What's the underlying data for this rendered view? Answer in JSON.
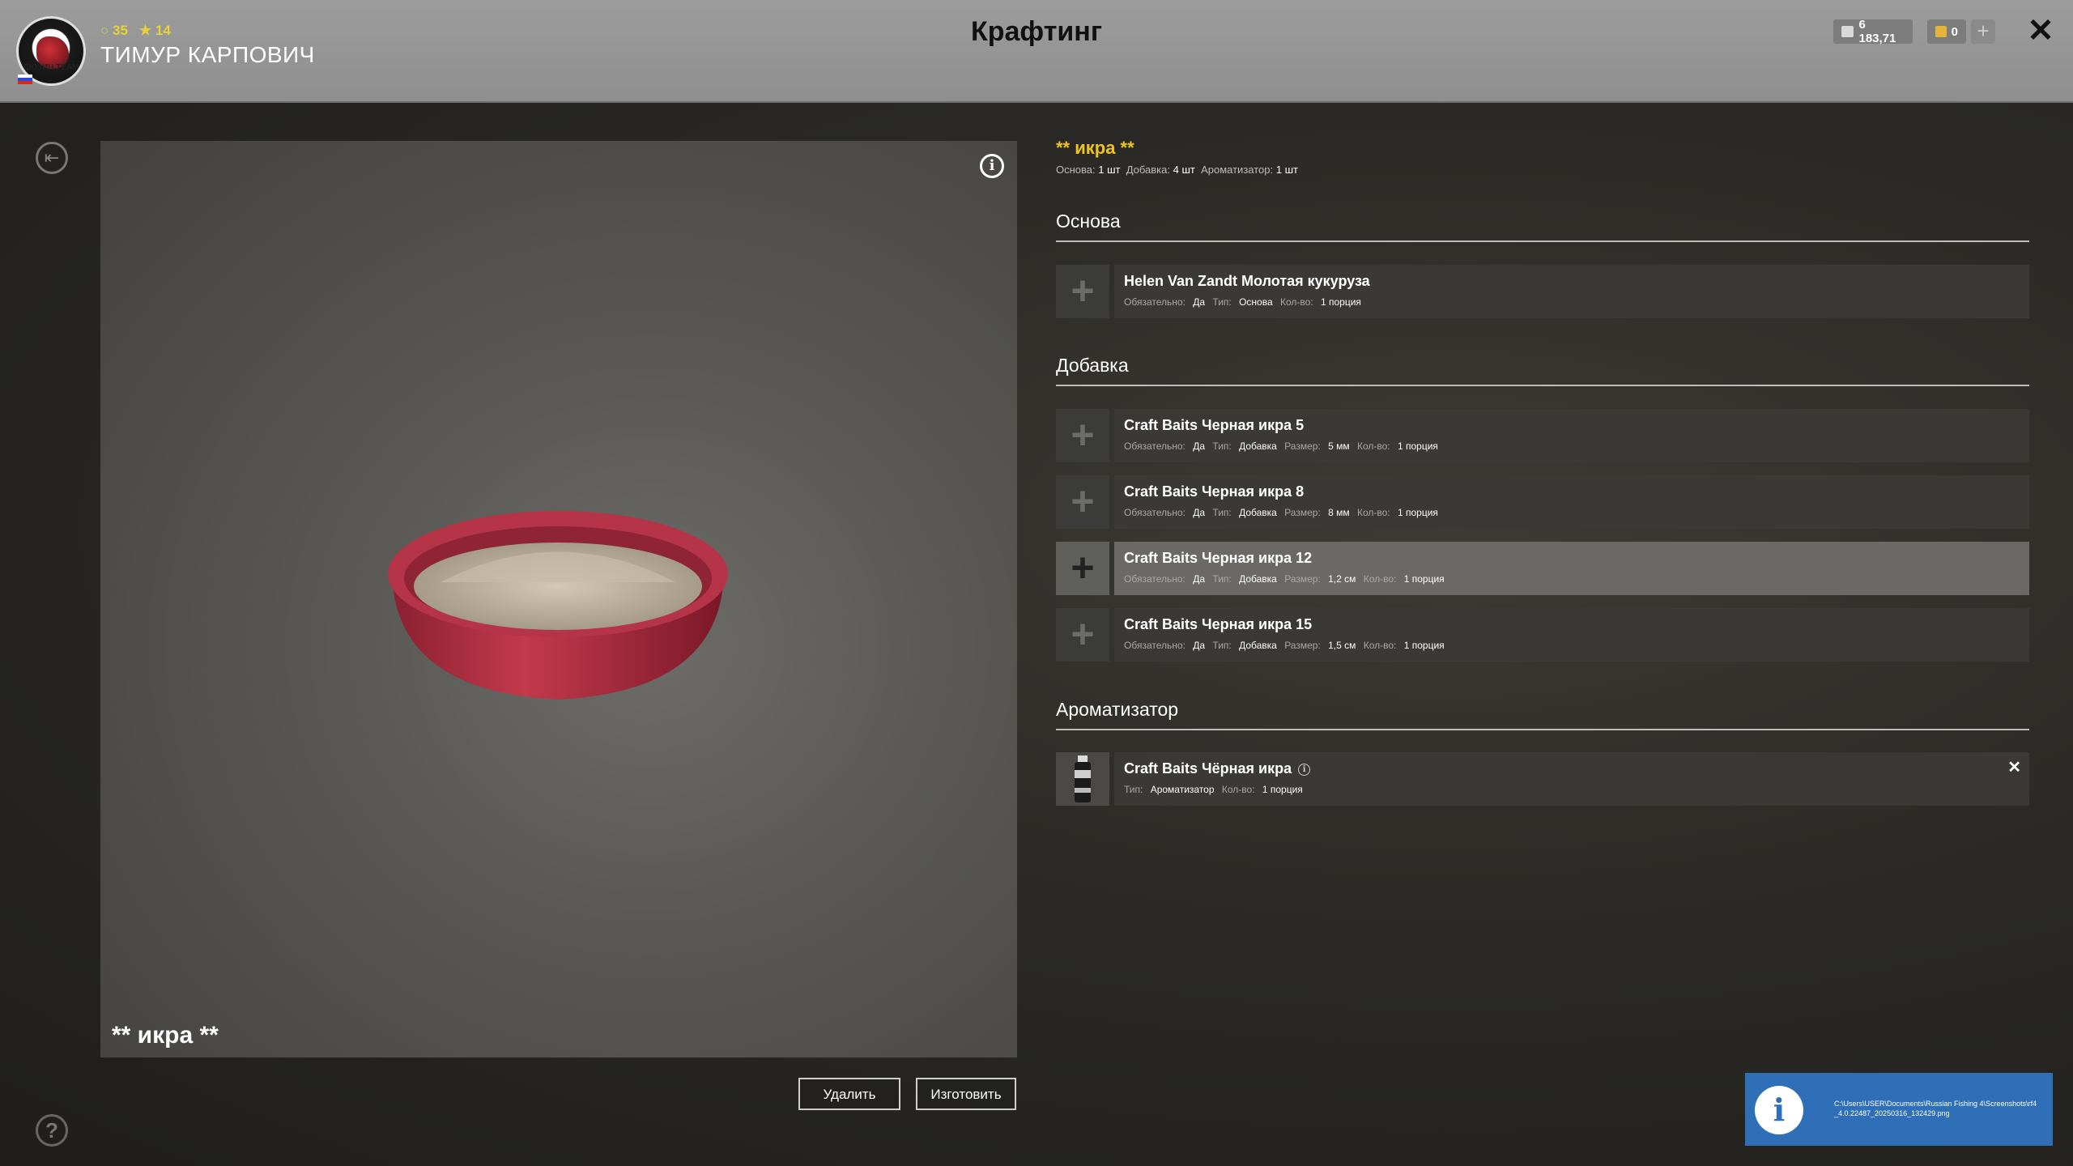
{
  "player": {
    "level": "35",
    "stars": "★ 14",
    "name": "ТИМУР КАРПОВИЧ",
    "avatar_text": "ДЮЗИЧ TEAM"
  },
  "header": {
    "title": "Крафтинг"
  },
  "wallet": {
    "silver": "6 183,71",
    "gold": "0",
    "plus": "+",
    "close": "✕"
  },
  "preview": {
    "name": "** икра **",
    "info": "i"
  },
  "actions": {
    "delete": "Удалить",
    "craft": "Изготовить"
  },
  "recipe": {
    "title": "** икра **",
    "summary": [
      {
        "label": "Основа:",
        "value": "1 шт"
      },
      {
        "label": "Добавка:",
        "value": "4 шт"
      },
      {
        "label": "Ароматизатор:",
        "value": "1 шт"
      }
    ]
  },
  "sections": {
    "base": {
      "title": "Основа",
      "items": [
        {
          "name": "Helen Van Zandt Молотая кукуруза",
          "meta": [
            [
              "Обязательно:",
              "Да"
            ],
            [
              "Тип:",
              "Основа"
            ],
            [
              "Кол-во:",
              "1 порция"
            ]
          ]
        }
      ]
    },
    "additive": {
      "title": "Добавка",
      "items": [
        {
          "name": "Craft Baits Черная икра 5",
          "meta": [
            [
              "Обязательно:",
              "Да"
            ],
            [
              "Тип:",
              "Добавка"
            ],
            [
              "Размер:",
              "5 мм"
            ],
            [
              "Кол-во:",
              "1 порция"
            ]
          ]
        },
        {
          "name": "Craft Baits Черная икра 8",
          "meta": [
            [
              "Обязательно:",
              "Да"
            ],
            [
              "Тип:",
              "Добавка"
            ],
            [
              "Размер:",
              "8 мм"
            ],
            [
              "Кол-во:",
              "1 порция"
            ]
          ]
        },
        {
          "name": "Craft Baits Черная икра 12",
          "meta": [
            [
              "Обязательно:",
              "Да"
            ],
            [
              "Тип:",
              "Добавка"
            ],
            [
              "Размер:",
              "1,2 см"
            ],
            [
              "Кол-во:",
              "1 порция"
            ]
          ]
        },
        {
          "name": "Craft Baits Черная икра 15",
          "meta": [
            [
              "Обязательно:",
              "Да"
            ],
            [
              "Тип:",
              "Добавка"
            ],
            [
              "Размер:",
              "1,5 см"
            ],
            [
              "Кол-во:",
              "1 порция"
            ]
          ]
        }
      ]
    },
    "flavor": {
      "title": "Ароматизатор",
      "items": [
        {
          "name": "Craft Baits Чёрная икра",
          "meta": [
            [
              "Тип:",
              "Ароматизатор"
            ],
            [
              "Кол-во:",
              "1 порция"
            ]
          ]
        }
      ]
    }
  },
  "toast": {
    "icon": "i",
    "path": "C:\\Users\\USER\\Documents\\Russian Fishing 4\\Screenshots\\rf4_4.0.22487_20250316_132429.png"
  },
  "icons": {
    "back": "back-icon",
    "help": "?",
    "add_slot": "+"
  },
  "colors": {
    "accent": "#f0c419",
    "topbar": "#9c9c9c",
    "toast": "#2f6fb7"
  }
}
